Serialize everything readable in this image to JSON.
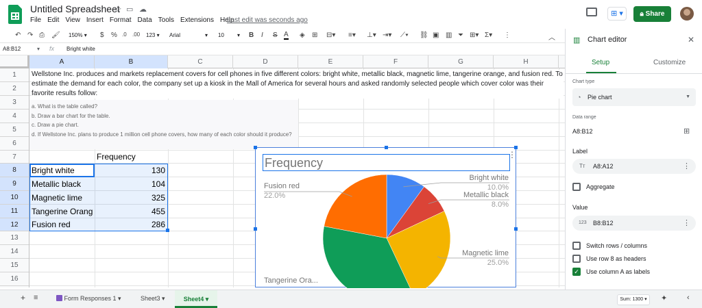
{
  "app": {
    "doc_title": "Untitled Spreadsheet",
    "menus": [
      "File",
      "Edit",
      "View",
      "Insert",
      "Format",
      "Data",
      "Tools",
      "Extensions",
      "Help"
    ],
    "last_edit": "Last edit was seconds ago",
    "share_label": "Share"
  },
  "toolbar": {
    "zoom": "150%",
    "currency": "$",
    "percent": "%",
    "decimal_less": ".0",
    "decimal_more": ".00",
    "more_formats": "123",
    "font": "Arial",
    "font_size": "10",
    "bold": "B",
    "italic": "I",
    "strike": "S",
    "text_color": "A"
  },
  "formula_bar": {
    "name_box": "A8:B12",
    "fx": "fx",
    "value": "Bright white"
  },
  "columns": [
    "A",
    "B",
    "C",
    "D",
    "E",
    "F",
    "G",
    "H"
  ],
  "rows": [
    "1",
    "2",
    "3",
    "4",
    "5",
    "6",
    "7",
    "8",
    "9",
    "10",
    "11",
    "12",
    "13",
    "14",
    "15",
    "16"
  ],
  "sheet": {
    "paragraph": "Wellstone Inc. produces and markets replacement covers for cell phones in five different colors: bright white, metallic black, magnetic lime, tangerine orange, and fusion red. To estimate the demand for each color, the company set up a kiosk in the Mall of America for several hours and asked randomly selected people which cover color was their favorite results follow:",
    "questions": [
      "a. What is the table called?",
      "b. Draw a bar chart for the table.",
      "c. Draw a pie chart.",
      "d. If Wellstone Inc. plans to produce 1 million cell phone covers, how many of each color should it produce?"
    ],
    "header_b7": "Frequency",
    "table": [
      {
        "color": "Bright white",
        "freq": "130"
      },
      {
        "color": "Metallic black",
        "freq": "104"
      },
      {
        "color": "Magnetic lime",
        "freq": "325"
      },
      {
        "color": "Tangerine Orang",
        "freq": "455"
      },
      {
        "color": "Fusion red",
        "freq": "286"
      }
    ]
  },
  "chart_data": {
    "type": "pie",
    "title": "Frequency",
    "categories": [
      "Bright white",
      "Metallic black",
      "Magnetic lime",
      "Tangerine Orange",
      "Fusion red"
    ],
    "values": [
      130,
      104,
      325,
      455,
      286
    ],
    "colors": [
      "#4285f4",
      "#db4437",
      "#f4b400",
      "#0f9d58",
      "#ff6d01"
    ],
    "visible_labels": {
      "bright_white": {
        "name": "Bright white",
        "pct": "10.0%"
      },
      "metallic_black": {
        "name": "Metallic black",
        "pct": "8.0%"
      },
      "magnetic_lime": {
        "name": "Magnetic lime",
        "pct": "25.0%"
      },
      "fusion_red": {
        "name": "Fusion red",
        "pct": "22.0%"
      },
      "tangerine": {
        "name": "Tangerine Ora..."
      }
    }
  },
  "bottom": {
    "tabs": [
      "Form Responses 1",
      "Sheet3",
      "Sheet4"
    ],
    "sum": "Sum: 1300"
  },
  "editor": {
    "title": "Chart editor",
    "tab_setup": "Setup",
    "tab_customize": "Customize",
    "chart_type_label": "Chart type",
    "chart_type_value": "Pie chart",
    "data_range_label": "Data range",
    "data_range_value": "A8:B12",
    "label_heading": "Label",
    "label_range": "A8:A12",
    "aggregate": "Aggregate",
    "value_heading": "Value",
    "value_range": "B8:B12",
    "opt_switch": "Switch rows / columns",
    "opt_row8": "Use row 8 as headers",
    "opt_colA": "Use column A as labels",
    "opt_colA_checked": true,
    "accent": "#188038"
  }
}
